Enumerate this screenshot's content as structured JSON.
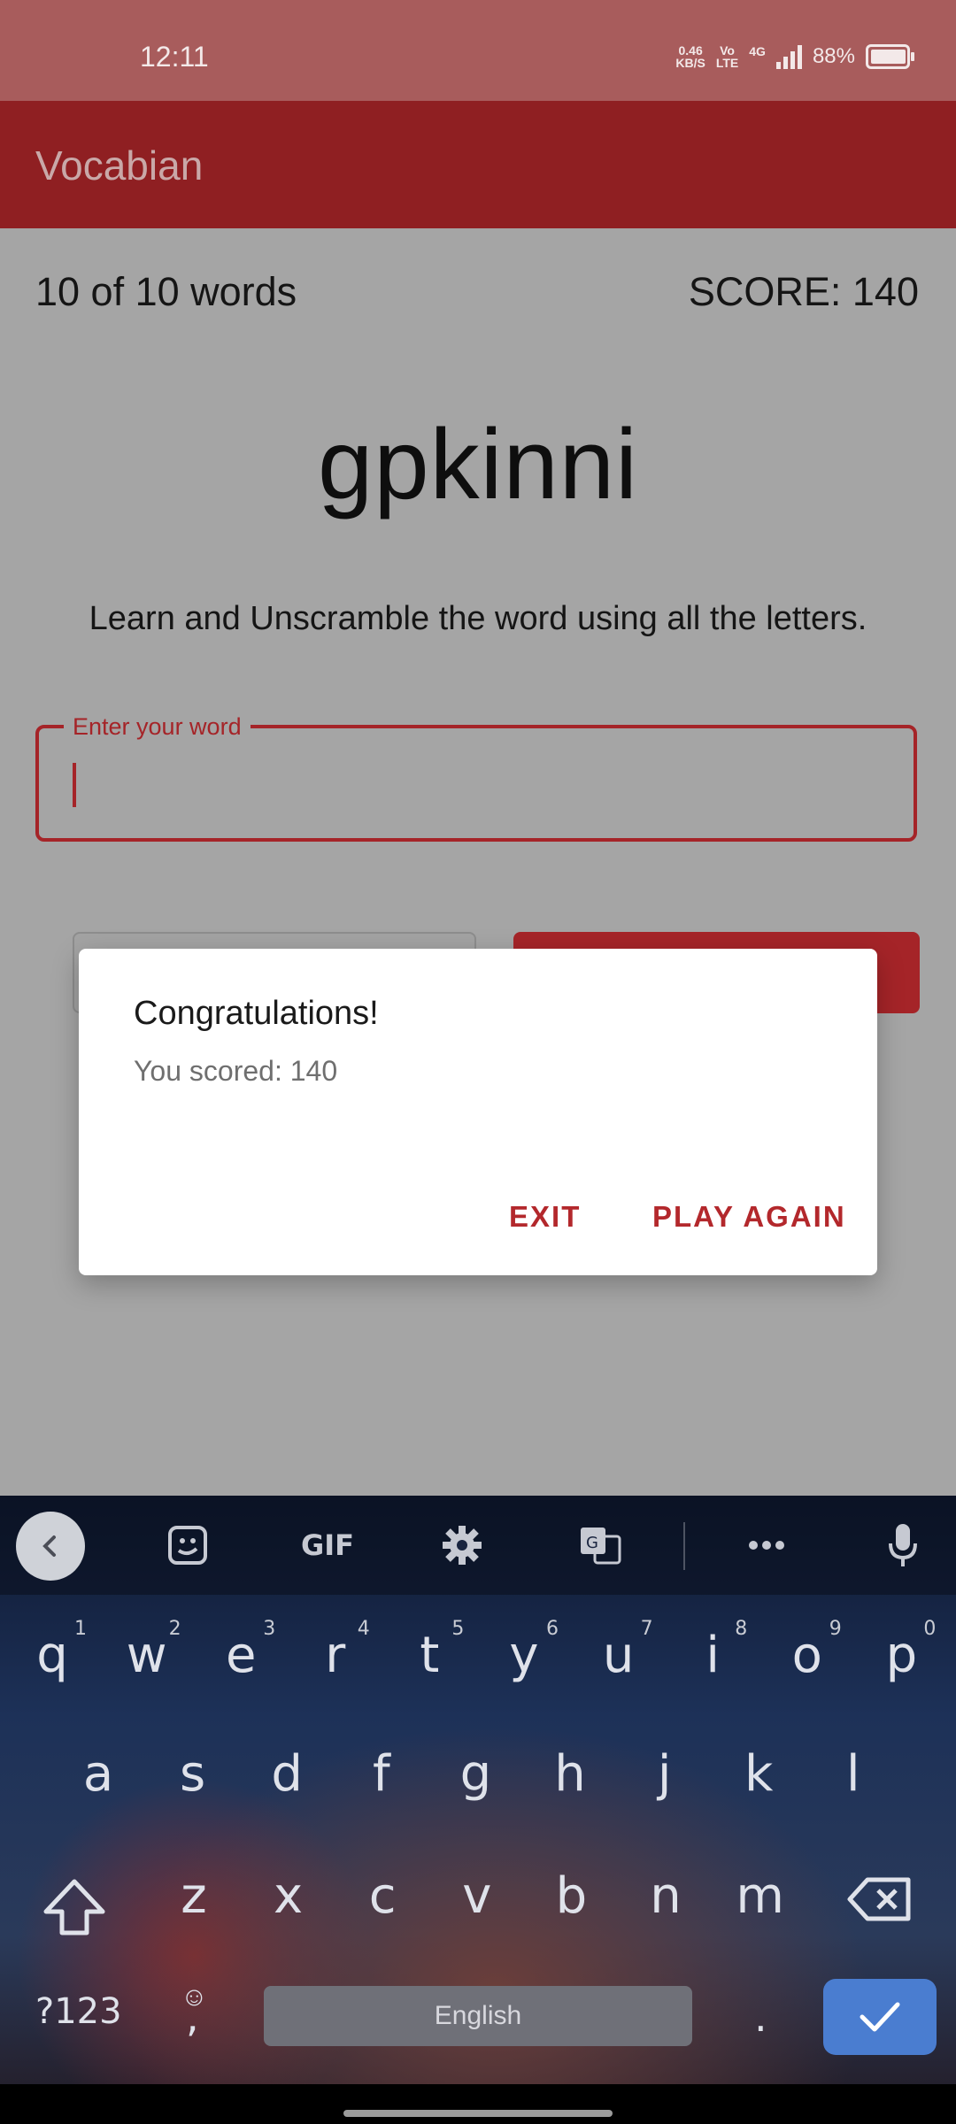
{
  "status_bar": {
    "time": "12:11",
    "net_speed_value": "0.46",
    "net_speed_unit": "KB/S",
    "volte_top": "Vo",
    "volte_bottom": "LTE",
    "network": "4G",
    "battery": "88%"
  },
  "app_bar": {
    "title": "Vocabian"
  },
  "game": {
    "progress": "10 of 10 words",
    "score": "SCORE: 140",
    "scrambled_word": "gpkinni",
    "instructions": "Learn and Unscramble the word using all the letters.",
    "input_label": "Enter your word",
    "input_value": ""
  },
  "dialog": {
    "title": "Congratulations!",
    "message": "You scored: 140",
    "exit_label": "EXIT",
    "play_again_label": "PLAY AGAIN"
  },
  "keyboard": {
    "toolbar": {
      "gif_label": "GIF"
    },
    "row1": [
      {
        "key": "q",
        "num": "1"
      },
      {
        "key": "w",
        "num": "2"
      },
      {
        "key": "e",
        "num": "3"
      },
      {
        "key": "r",
        "num": "4"
      },
      {
        "key": "t",
        "num": "5"
      },
      {
        "key": "y",
        "num": "6"
      },
      {
        "key": "u",
        "num": "7"
      },
      {
        "key": "i",
        "num": "8"
      },
      {
        "key": "o",
        "num": "9"
      },
      {
        "key": "p",
        "num": "0"
      }
    ],
    "row2": [
      "a",
      "s",
      "d",
      "f",
      "g",
      "h",
      "j",
      "k",
      "l"
    ],
    "row3": [
      "z",
      "x",
      "c",
      "v",
      "b",
      "n",
      "m"
    ],
    "symbols_label": "?123",
    "comma_label": ",",
    "space_label": "English",
    "period_label": "."
  },
  "colors": {
    "app_bar": "#8f1f22",
    "status_bar": "#a85c5c",
    "accent": "#a52428",
    "enter_key": "#4a7dd0"
  }
}
